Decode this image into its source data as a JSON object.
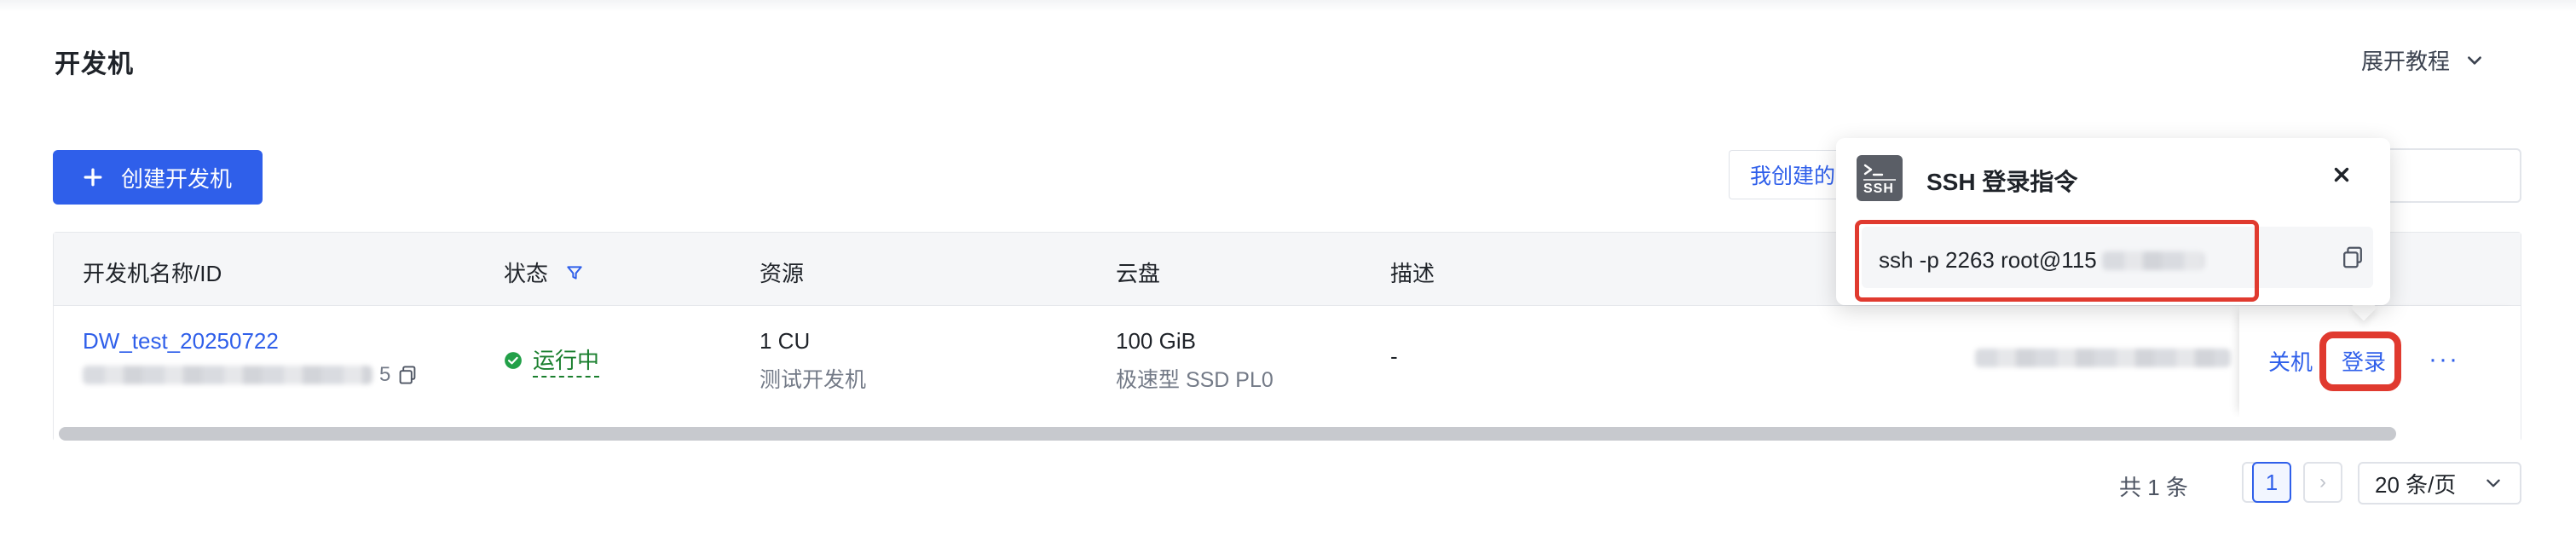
{
  "page": {
    "title": "开发机",
    "tutorial_toggle": "展开教程"
  },
  "toolbar": {
    "create_button": "创建开发机",
    "filter_tab_visible_text": "我创建的"
  },
  "table": {
    "columns": [
      "开发机名称/ID",
      "状态",
      "资源",
      "云盘",
      "描述"
    ],
    "rows": [
      {
        "name": "DW_test_20250722",
        "id_visible_suffix": "5",
        "status": "运行中",
        "resource": "1 CU",
        "resource_desc": "测试开发机",
        "disk": "100 GiB",
        "disk_type": "极速型 SSD PL0",
        "description": "-"
      }
    ],
    "actions": {
      "shutdown": "关机",
      "login": "登录",
      "more": "···"
    }
  },
  "pagination": {
    "total": "共 1 条",
    "current_page": "1",
    "prev": "‹",
    "next": "›",
    "page_size": "20 条/页"
  },
  "ssh_popover": {
    "icon_label": "SSH",
    "title": "SSH 登录指令",
    "close_icon": "close-icon",
    "command": "ssh -p 2263 root@115",
    "copy_icon": "copy-icon"
  },
  "colors": {
    "primary": "#2f5fea",
    "success": "#1a7f2e",
    "highlight": "#e03a2f"
  }
}
